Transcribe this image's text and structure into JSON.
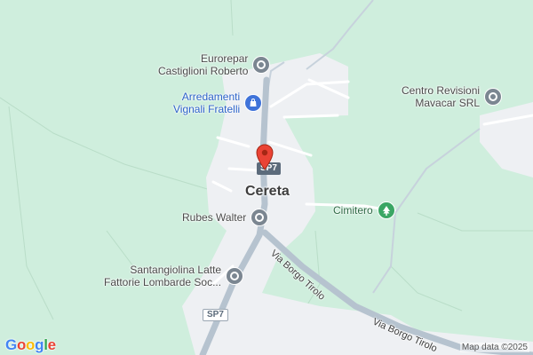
{
  "map": {
    "town_label": "Cereta",
    "colors": {
      "background": "#cfeedd",
      "built_area": "#eef0f3",
      "road": "#ffffff",
      "main_road": "#b6c3cf",
      "marker": "#ea4335",
      "poi_gray": "#7b8691",
      "poi_blue": "#3f73d9",
      "poi_green": "#3aa664"
    },
    "pois": [
      {
        "lines": [
          "Eurorepar",
          "Castiglioni Roberto"
        ],
        "icon": "generic-poi-icon"
      },
      {
        "lines": [
          "Arredamenti",
          "Vignali Fratelli"
        ],
        "icon": "shopping-bag-icon"
      },
      {
        "lines": [
          "Centro Revisioni",
          "Mavacar SRL"
        ],
        "icon": "generic-poi-icon"
      },
      {
        "lines": [
          "Cimitero"
        ],
        "icon": "tree-icon"
      },
      {
        "lines": [
          "Rubes Walter"
        ],
        "icon": "generic-poi-icon"
      },
      {
        "lines": [
          "Santangiolina Latte",
          "Fattorie Lombarde Soc..."
        ],
        "icon": "generic-poi-icon"
      }
    ],
    "road_shields": [
      "SP7",
      "SP7"
    ],
    "streets": [
      "Via Borgo Tirolo",
      "Via Borgo Tirolo"
    ],
    "marker_icon": "location-pin-icon",
    "logo": {
      "text": "Google",
      "letter_colors": [
        "#4285F4",
        "#EA4335",
        "#FBBC05",
        "#4285F4",
        "#34A853",
        "#EA4335"
      ]
    },
    "attribution": "Map data ©2025"
  }
}
